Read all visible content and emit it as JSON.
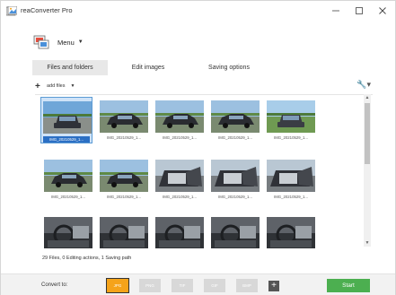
{
  "window": {
    "title": "reaConverter Pro",
    "minimize_icon": "minimize-icon",
    "maximize_icon": "maximize-icon",
    "close_icon": "close-icon"
  },
  "menu": {
    "label": "Menu"
  },
  "tabs": [
    {
      "label": "Files and folders",
      "active": true
    },
    {
      "label": "Edit images",
      "active": false
    },
    {
      "label": "Saving options",
      "active": false
    }
  ],
  "toolbar": {
    "add_files_label": "add files"
  },
  "gallery": {
    "items": [
      {
        "caption": "IMG_20210529_1...",
        "selected": true,
        "scene": "car-front-blue"
      },
      {
        "caption": "IMG_20210529_1...",
        "selected": false,
        "scene": "car-side-dark"
      },
      {
        "caption": "IMG_20210529_1...",
        "selected": false,
        "scene": "car-side-dark"
      },
      {
        "caption": "IMG_20210529_1...",
        "selected": false,
        "scene": "car-side-dark"
      },
      {
        "caption": "IMG_20210529_1...",
        "selected": false,
        "scene": "car-front-green"
      },
      {
        "caption": "IMG_20210529_1...",
        "selected": false,
        "scene": "car-side-dark"
      },
      {
        "caption": "IMG_20210529_1...",
        "selected": false,
        "scene": "car-side-dark"
      },
      {
        "caption": "IMG_20210529_1...",
        "selected": false,
        "scene": "car-door-open"
      },
      {
        "caption": "IMG_20210529_1...",
        "selected": false,
        "scene": "car-door-open"
      },
      {
        "caption": "IMG_20210529_1...",
        "selected": false,
        "scene": "car-door-open"
      },
      {
        "caption": "",
        "selected": false,
        "scene": "car-interior"
      },
      {
        "caption": "",
        "selected": false,
        "scene": "car-interior"
      },
      {
        "caption": "",
        "selected": false,
        "scene": "car-interior"
      },
      {
        "caption": "",
        "selected": false,
        "scene": "car-interior"
      },
      {
        "caption": "",
        "selected": false,
        "scene": "car-interior"
      }
    ]
  },
  "status": {
    "text": "29 Files, 0 Editing actions, 1 Saving path"
  },
  "bottom": {
    "convert_label": "Convert to:",
    "formats": [
      {
        "label": "JPG",
        "active": true
      },
      {
        "label": "PNG",
        "active": false
      },
      {
        "label": "TIF",
        "active": false
      },
      {
        "label": "GIF",
        "active": false
      },
      {
        "label": "BMP",
        "active": false
      }
    ],
    "add_format_label": "+",
    "start_label": "Start"
  },
  "colors": {
    "accent_orange": "#f5a31a",
    "start_green": "#4caf50",
    "selection_blue": "#2b6fc4"
  }
}
